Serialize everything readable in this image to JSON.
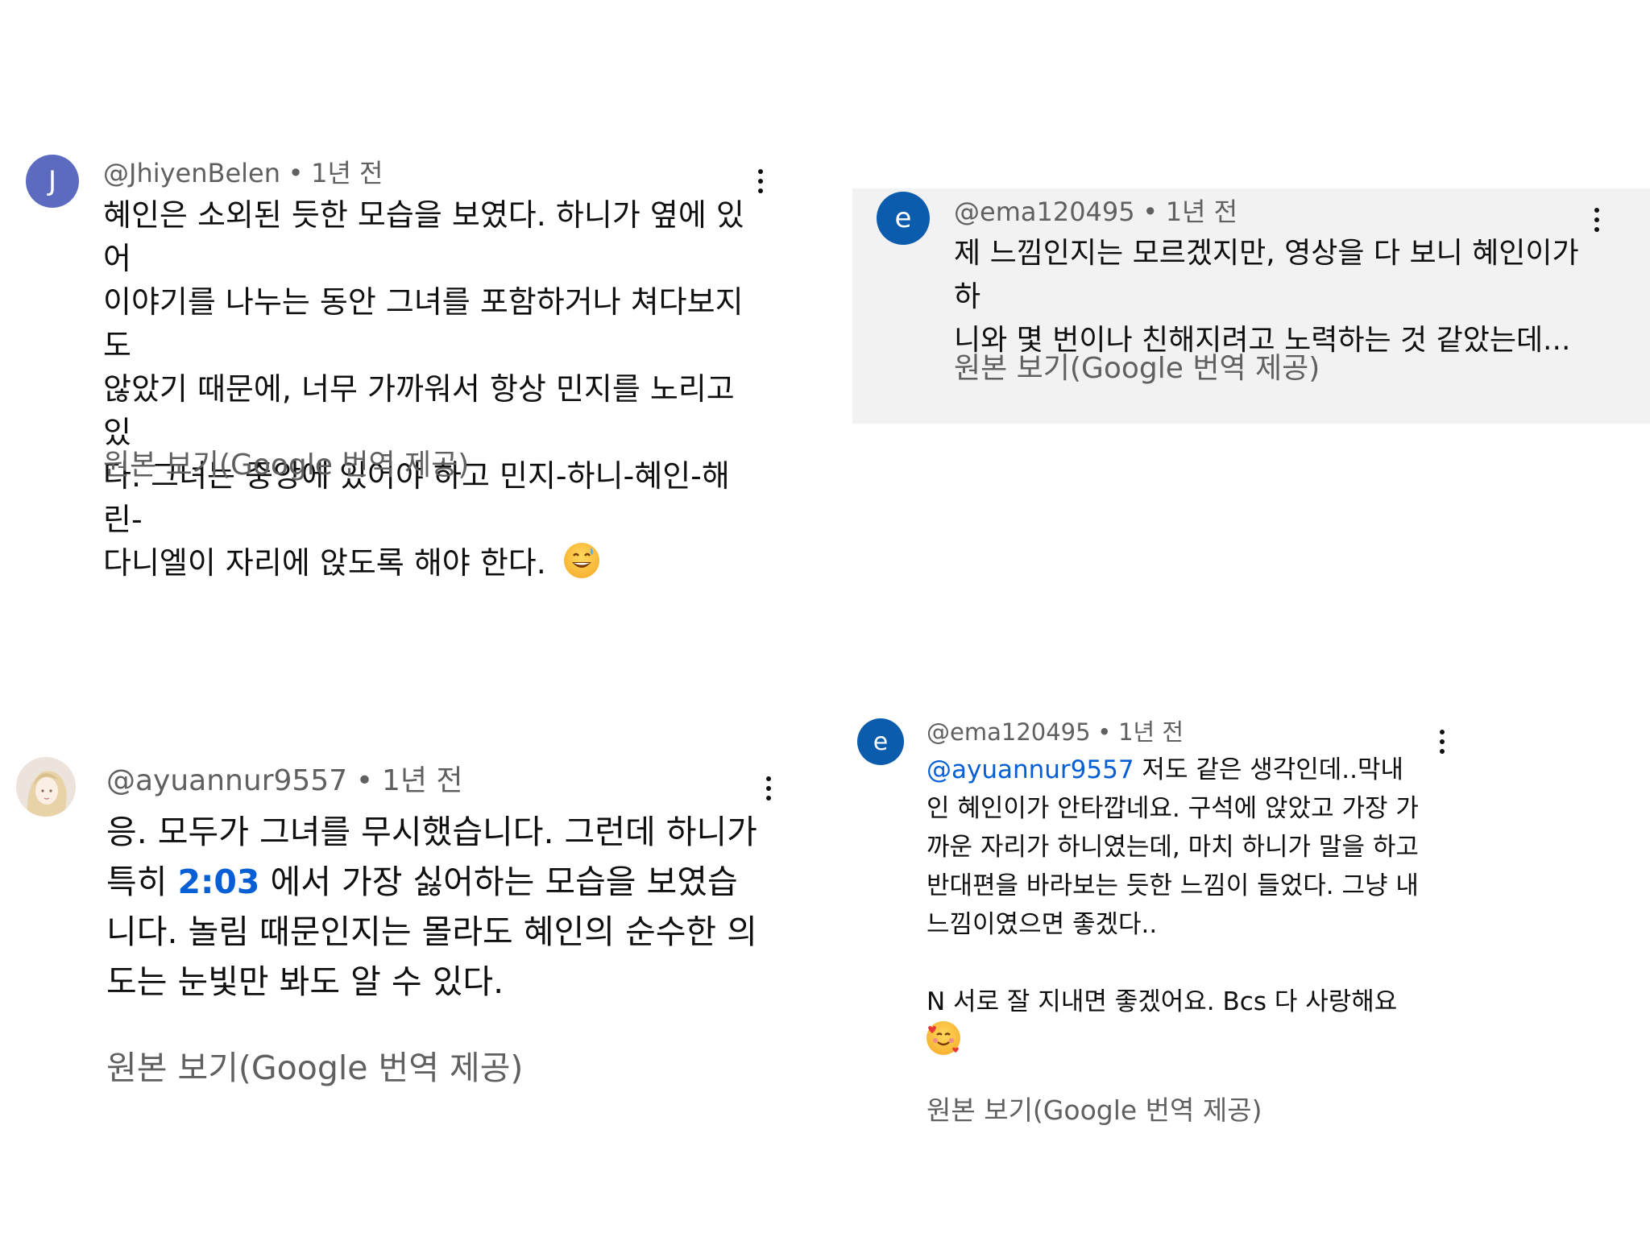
{
  "comments": [
    {
      "avatar_letter": "J",
      "username": "@JhiyenBelen",
      "time": "1년 전",
      "text_lines": [
        "혜인은 소외된 듯한 모습을 보였다. 하니가 옆에 있어",
        "이야기를 나누는 동안 그녀를 포함하거나 쳐다보지도",
        "않았기 때문에, 너무 가까워서 항상 민지를 노리고 있",
        "다. 그녀는 중앙에 있어야 하고 민지-하니-혜인-해린-",
        "다니엘이 자리에 앉도록 해야 한다."
      ],
      "emoji": "grinning-sweat-emoji",
      "see_original": "원본 보기(Google 번역 제공)"
    },
    {
      "avatar_letter": "e",
      "username": "@ema120495",
      "time": "1년 전",
      "text_lines": [
        "제 느낌인지는 모르겠지만, 영상을 다 보니 혜인이가 하",
        "니와 몇 번이나 친해지려고 노력하는 것 같았는데..."
      ],
      "see_original": "원본 보기(Google 번역 제공)",
      "highlighted": true
    },
    {
      "avatar_image": "anime-girl-avatar",
      "username": "@ayuannur9557",
      "time": "1년 전",
      "line1": "응. 모두가 그녀를 무시했습니다. 그런데 하니가",
      "line2_before": "특히 ",
      "timestamp_link": "2:03",
      "line2_after": " 에서 가장 싫어하는 모습을 보였습",
      "line3": "니다. 놀림 때문인지는 몰라도 혜인의 순수한 의",
      "line4": "도는 눈빛만 봐도 알 수 있다.",
      "see_original": "원본 보기(Google 번역 제공)"
    },
    {
      "avatar_letter": "e",
      "username": "@ema120495",
      "time": "1년 전",
      "mention": "@ayuannur9557",
      "line1_after": " 저도 같은 생각인데..막내",
      "lines": [
        "인 혜인이가 안타깝네요. 구석에 앉았고 가장 가",
        "까운 자리가 하니였는데, 마치 하니가 말을 하고",
        "반대편을 바라보는 듯한 느낌이 들었다. 그냥 내",
        "느낌이였으면 좋겠다.."
      ],
      "line_after_gap": "N 서로 잘 지내면 좋겠어요. Bcs 다 사랑해요",
      "emoji": "smiling-hearts-emoji",
      "see_original": "원본 보기(Google 번역 제공)"
    }
  ],
  "colors": {
    "link": "#065fd4",
    "meta": "#606060",
    "highlight_bg": "#f2f2f2",
    "avatar_j": "#5c6bc0",
    "avatar_e": "#0b5cad"
  }
}
